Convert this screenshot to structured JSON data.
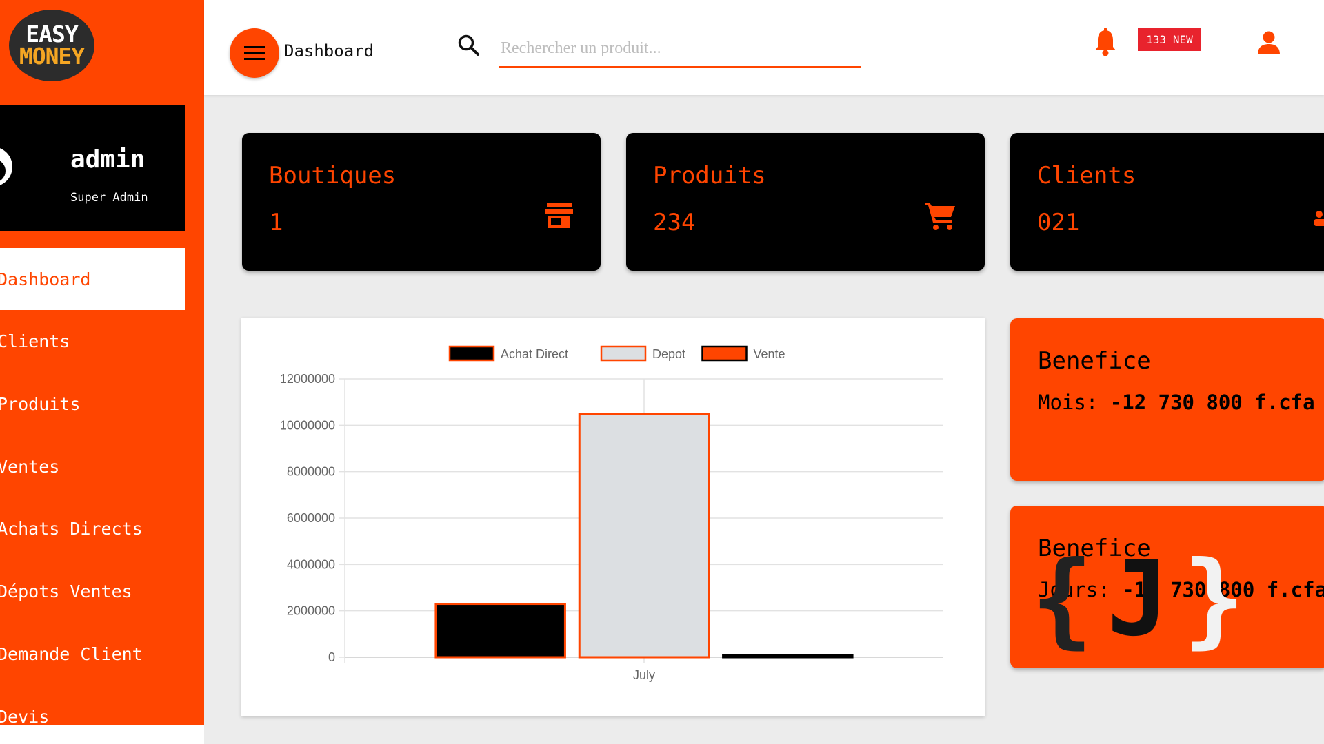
{
  "brand": {
    "logo_line1": "EASY",
    "logo_line2": "MONEY"
  },
  "profile": {
    "name": "admin",
    "role": "Super Admin"
  },
  "sidebar": {
    "items": [
      {
        "label": "Dashboard",
        "active": true
      },
      {
        "label": "Clients"
      },
      {
        "label": "Produits"
      },
      {
        "label": "Ventes"
      },
      {
        "label": "Achats Directs"
      },
      {
        "label": "Dépots Ventes"
      },
      {
        "label": "Demande Client"
      },
      {
        "label": "Devis"
      }
    ]
  },
  "topbar": {
    "title": "Dashboard",
    "search_placeholder": "Rechercher un produit...",
    "notification_badge": "133 NEW"
  },
  "stats": [
    {
      "label": "Boutiques",
      "value": "1",
      "icon": "store-icon"
    },
    {
      "label": "Produits",
      "value": "234",
      "icon": "cart-icon"
    },
    {
      "label": "Clients",
      "value": "021",
      "icon": "people-icon"
    }
  ],
  "profit": [
    {
      "title": "Benefice",
      "prefix": "Mois:",
      "amount": "-12 730 800 f.cfa"
    },
    {
      "title": "Benefice",
      "prefix": "Jours:",
      "amount": "-10 730 800 f.cfa"
    }
  ],
  "watermark": {
    "left": "{",
    "middle": "J",
    "right": "}"
  },
  "colors": {
    "accent": "#ff4500",
    "dark": "#000000",
    "depot": "#dcdfe2"
  },
  "chart_data": {
    "type": "bar",
    "categories": [
      "July"
    ],
    "series": [
      {
        "name": "Achat Direct",
        "values": [
          2300000
        ],
        "color": "#000000",
        "border": "#ff4500"
      },
      {
        "name": "Depot",
        "values": [
          10500000
        ],
        "color": "#dcdfe2",
        "border": "#ff4500"
      },
      {
        "name": "Vente",
        "values": [
          80000
        ],
        "color": "#ff4500",
        "border": "#000000"
      }
    ],
    "y_ticks": [
      "0",
      "2000000",
      "4000000",
      "6000000",
      "8000000",
      "10000000",
      "12000000"
    ],
    "ylim": [
      0,
      12000000
    ],
    "legend": "top",
    "grid": true
  }
}
